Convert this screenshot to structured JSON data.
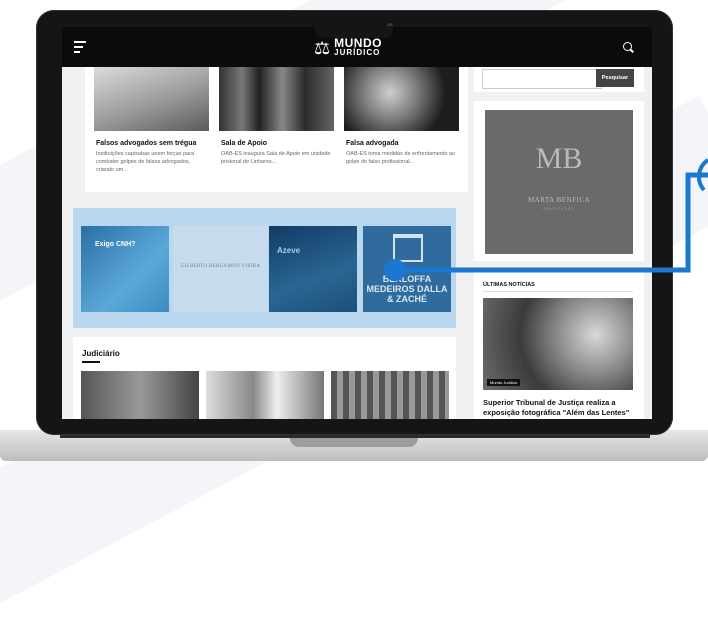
{
  "site": {
    "logo_line1": "MUNDO",
    "logo_line2": "JURÍDICO"
  },
  "news": [
    {
      "title": "Falsos advogados sem trégua",
      "desc": "Instituições capixabas unem forças para combater golpes de falsos advogados, criando um..."
    },
    {
      "title": "Sala de Apoio",
      "desc": "OAB-ES inaugura Sala de Apoio em unidade prisional de Linhares..."
    },
    {
      "title": "Falsa advogada",
      "desc": "OAB-ES toma medidas de enfrentamento ao golpe do falso profissional..."
    }
  ],
  "ads": {
    "ad1": "Exigo CNH?",
    "ad2": "GILBERTO BERGAMINI VIEIRA",
    "ad3": "Azeve",
    "ad4": "BERLOFFA MEDEIROS DALLA & ZACHÉ"
  },
  "section": {
    "title": "Judiciário"
  },
  "sidebar": {
    "search_button": "Pesquisar",
    "banner_logo": "MB",
    "banner_name": "MARTA BENFICA",
    "banner_sub": "ADVOGADOS",
    "latest_title": "ÚLTIMAS NOTÍCIAS",
    "latest_badge": "Mundo Jurídico",
    "latest_headline": "Superior Tribunal de Justiça realiza a exposição fotográfica \"Além das Lentes\""
  },
  "colors": {
    "highlight": "#b9d8ef",
    "connector": "#1a78d0"
  }
}
